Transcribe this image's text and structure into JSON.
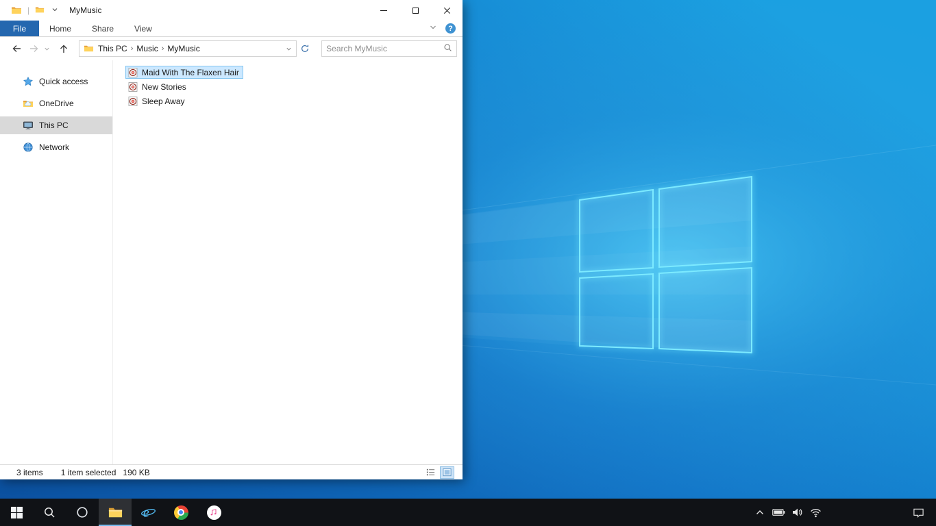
{
  "explorer": {
    "title": "MyMusic",
    "titlebar": {
      "qat_separator": "|"
    },
    "ribbon": {
      "tabs": [
        {
          "label": "File"
        },
        {
          "label": "Home"
        },
        {
          "label": "Share"
        },
        {
          "label": "View"
        }
      ],
      "help_glyph": "?"
    },
    "navigation": {
      "breadcrumb": {
        "segments": [
          {
            "label": "This PC"
          },
          {
            "label": "Music"
          },
          {
            "label": "MyMusic"
          }
        ],
        "separator": "›"
      },
      "search": {
        "placeholder": "Search MyMusic",
        "value": ""
      }
    },
    "sidebar": {
      "items": [
        {
          "label": "Quick access",
          "icon": "star-icon",
          "selected": false
        },
        {
          "label": "OneDrive",
          "icon": "onedrive-icon",
          "selected": false
        },
        {
          "label": "This PC",
          "icon": "pc-icon",
          "selected": true
        },
        {
          "label": "Network",
          "icon": "network-icon",
          "selected": false
        }
      ]
    },
    "files": [
      {
        "name": "Maid With The Flaxen Hair",
        "icon": "music-file-icon",
        "selected": true
      },
      {
        "name": "New Stories",
        "icon": "music-file-icon",
        "selected": false
      },
      {
        "name": "Sleep Away",
        "icon": "music-file-icon",
        "selected": false
      }
    ],
    "statusbar": {
      "item_count": "3 items",
      "selection_summary": "1 item selected",
      "selection_size": "190 KB"
    }
  },
  "taskbar": {
    "buttons": [
      {
        "name": "start"
      },
      {
        "name": "search"
      },
      {
        "name": "cortana"
      },
      {
        "name": "file-explorer",
        "active": true
      },
      {
        "name": "internet-explorer"
      },
      {
        "name": "chrome"
      },
      {
        "name": "itunes"
      }
    ],
    "tray": [
      "hidden-icons-chevron",
      "battery",
      "volume",
      "wifi",
      "action-center"
    ]
  },
  "colors": {
    "file_tab_blue": "#2467af",
    "selection_fill": "#cce8ff",
    "selection_border": "#84c5f0",
    "sidebar_selected": "#d9d9d9",
    "taskbar_background": "#101216",
    "taskbar_active_underline": "#76b9ed",
    "wallpaper_dark": "#0b4f9e",
    "wallpaper_light": "#1ba0e1",
    "logo_glow": "#7ceaff"
  }
}
